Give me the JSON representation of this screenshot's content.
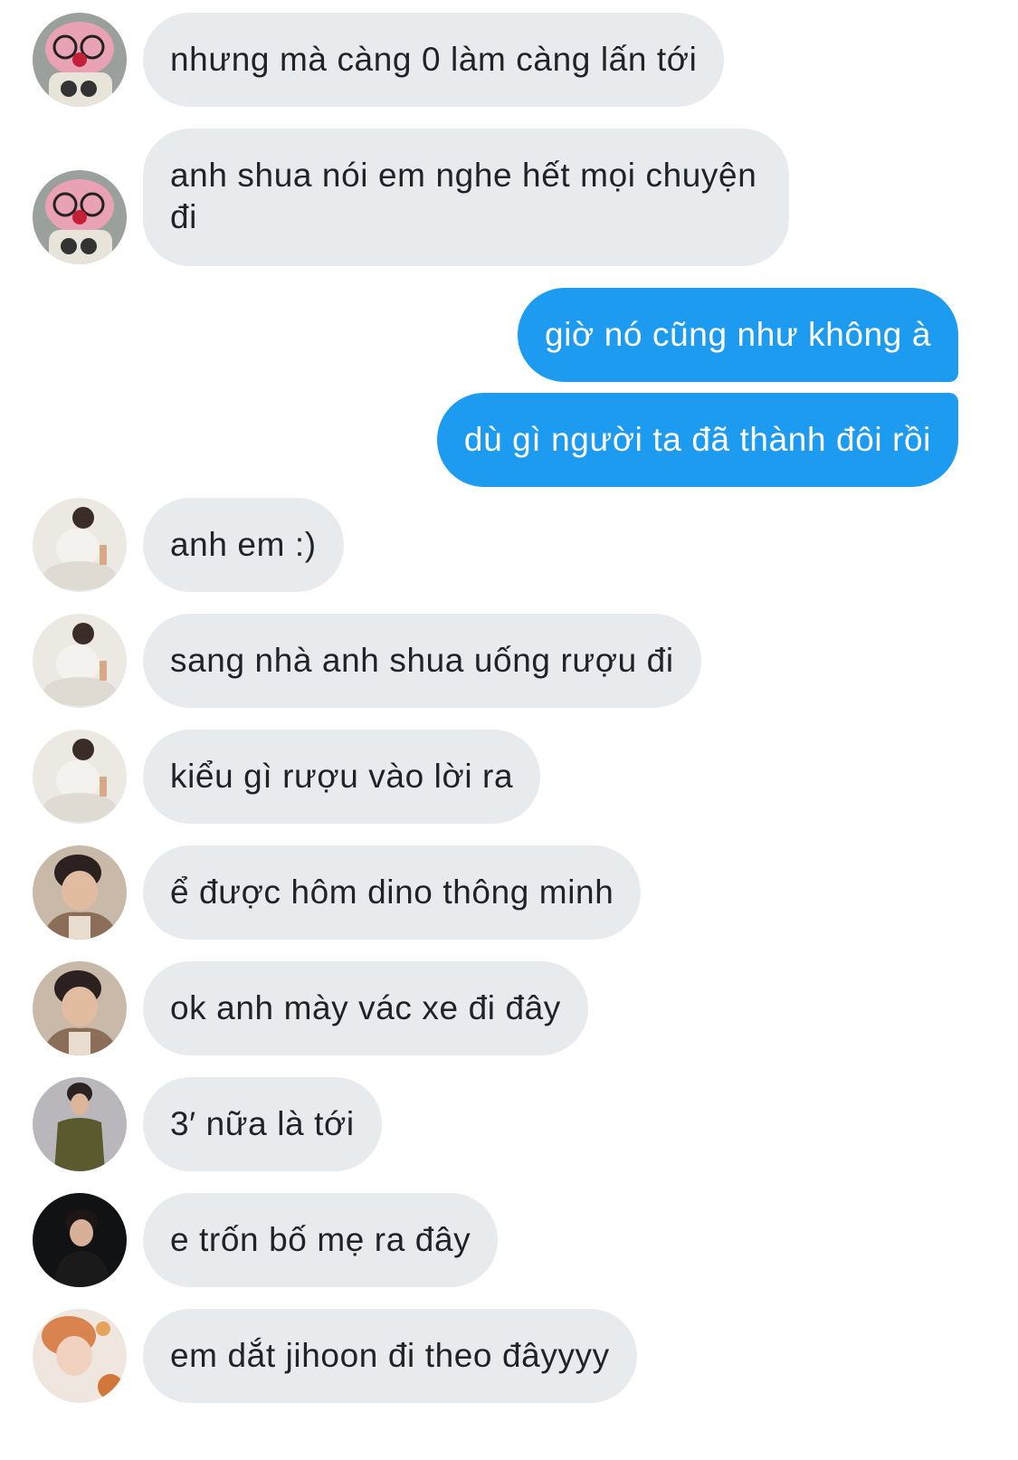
{
  "messages": [
    {
      "side": "in",
      "avatar": "pink-plush-avatar",
      "text": "nhưng mà càng 0 làm càng lấn tới"
    },
    {
      "side": "in",
      "avatar": "pink-plush-avatar",
      "text": "anh shua nói em nghe hết mọi chuyện đi"
    },
    {
      "side": "out",
      "text": "giờ nó cũng như không à"
    },
    {
      "side": "out",
      "text": "dù gì người ta đã thành đôi rồi"
    },
    {
      "side": "in",
      "avatar": "white-shirt-avatar",
      "text": "anh em :)"
    },
    {
      "side": "in",
      "avatar": "white-shirt-avatar",
      "text": "sang nhà anh shua uống rượu đi"
    },
    {
      "side": "in",
      "avatar": "white-shirt-avatar",
      "text": "kiểu gì rượu vào lời ra"
    },
    {
      "side": "in",
      "avatar": "hoodie-avatar",
      "text": "ể được hôm dino thông minh"
    },
    {
      "side": "in",
      "avatar": "hoodie-avatar",
      "text": "ok anh mày vác xe đi đây"
    },
    {
      "side": "in",
      "avatar": "olive-tee-avatar",
      "text": "3′ nữa là tới"
    },
    {
      "side": "in",
      "avatar": "dark-suit-avatar",
      "text": "e trốn bố mẹ ra đây"
    },
    {
      "side": "in",
      "avatar": "orange-hair-avatar",
      "text": "em dắt jihoon đi theo đâyyyy"
    }
  ],
  "colors": {
    "incoming_bubble": "#e8ebee",
    "incoming_text": "#1f2226",
    "outgoing_bubble": "#1d9bf0",
    "outgoing_text": "#ffffff"
  }
}
